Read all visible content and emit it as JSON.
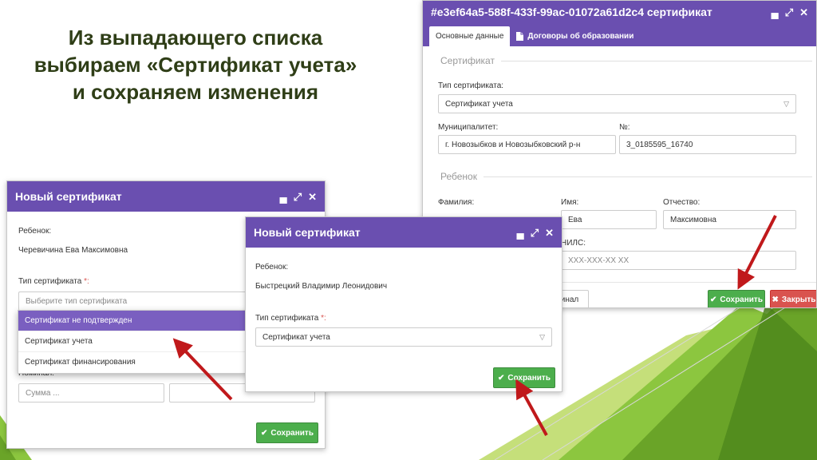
{
  "slide": {
    "title_lines": [
      "Из выпадающего списка",
      "выбираем «Сертификат учета»",
      "и сохраняем изменения"
    ]
  },
  "colors": {
    "titlebar": "#6a4fb0",
    "green_button": "#4cae4c",
    "red_button": "#d9534f",
    "dropdown_highlight": "#7a5fc0",
    "title_text": "#2f3e17",
    "arrow": "#c0191b"
  },
  "window_controls": {
    "minimize_icon": "minimize-icon",
    "maximize_icon": "maximize-icon",
    "close_icon": "close-icon"
  },
  "dialog_left": {
    "title": "Новый сертификат",
    "child_label": "Ребенок:",
    "child_value": "Черевичина Ева Максимовна",
    "type_label": "Тип сертификата",
    "required_mark": "*:",
    "type_placeholder": "Выберите тип сертификата",
    "dropdown_options": [
      "Сертификат не подтвержден",
      "Сертификат учета",
      "Сертификат финансирования"
    ],
    "nominal_label": "Номинал:",
    "sum_placeholder": "Сумма ...",
    "save_label": "Сохранить"
  },
  "dialog_mid": {
    "title": "Новый сертификат",
    "child_label": "Ребенок:",
    "child_value": "Быстрецкий Владимир Леонидович",
    "type_label": "Тип сертификата",
    "required_mark": "*:",
    "type_value": "Сертификат учета",
    "save_label": "Сохранить"
  },
  "dialog_right": {
    "title": "#e3ef64a5-588f-433f-99ac-01072a61d2c4 сертификат",
    "tabs": [
      "Основные данные",
      "Договоры об образовании"
    ],
    "section_certificate": "Сертификат",
    "type_label": "Тип сертификата:",
    "type_value": "Сертификат учета",
    "municipality_label": "Муниципалитет:",
    "municipality_value": "г. Новозыбков и Новозыбковский р-н",
    "number_label": "№:",
    "number_value": "3_0185595_16740",
    "section_child": "Ребенок",
    "surname_label": "Фамилия:",
    "name_label": "Имя:",
    "name_value": "Ева",
    "patronymic_label": "Отчество:",
    "patronymic_value": "Максимовна",
    "snils_label_partial": "НИЛС:",
    "snils_placeholder": "XXX-XXX-XX XX",
    "partial_button": "инал",
    "save_label": "Сохранить",
    "close_label": "Закрыть"
  }
}
